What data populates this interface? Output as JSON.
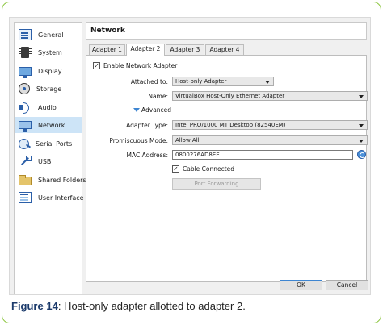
{
  "sidebar": {
    "items": [
      {
        "label": "General",
        "icon": "general-icon"
      },
      {
        "label": "System",
        "icon": "system-icon"
      },
      {
        "label": "Display",
        "icon": "display-icon"
      },
      {
        "label": "Storage",
        "icon": "storage-icon"
      },
      {
        "label": "Audio",
        "icon": "audio-icon"
      },
      {
        "label": "Network",
        "icon": "network-icon",
        "selected": true
      },
      {
        "label": "Serial Ports",
        "icon": "serial-ports-icon"
      },
      {
        "label": "USB",
        "icon": "usb-icon"
      },
      {
        "label": "Shared Folders",
        "icon": "shared-folders-icon"
      },
      {
        "label": "User Interface",
        "icon": "user-interface-icon"
      }
    ]
  },
  "page": {
    "title": "Network"
  },
  "tabs": [
    {
      "label": "Adapter 1"
    },
    {
      "label": "Adapter 2",
      "active": true
    },
    {
      "label": "Adapter 3"
    },
    {
      "label": "Adapter 4"
    }
  ],
  "form": {
    "enable_label": "Enable Network Adapter",
    "enable_checked": "✓",
    "attached_label": "Attached to:",
    "attached_value": "Host-only Adapter",
    "name_label": "Name:",
    "name_value": "VirtualBox Host-Only Ethernet Adapter",
    "advanced_label": "Advanced",
    "adapter_type_label": "Adapter Type:",
    "adapter_type_value": "Intel PRO/1000 MT Desktop (82540EM)",
    "promiscuous_label": "Promiscuous Mode:",
    "promiscuous_value": "Allow All",
    "mac_label": "MAC Address:",
    "mac_value": "0800276AD8EE",
    "cable_label": "Cable Connected",
    "cable_checked": "✓",
    "port_forwarding_label": "Port Forwarding"
  },
  "buttons": {
    "ok": "OK",
    "cancel": "Cancel"
  },
  "caption": {
    "label": "Figure",
    "number": "14",
    "text": ": Host-only adapter allotted to adapter 2."
  },
  "colors": {
    "frame_border": "#8cc63f",
    "selection": "#cde4f7",
    "caption_label": "#1b3a6b"
  }
}
